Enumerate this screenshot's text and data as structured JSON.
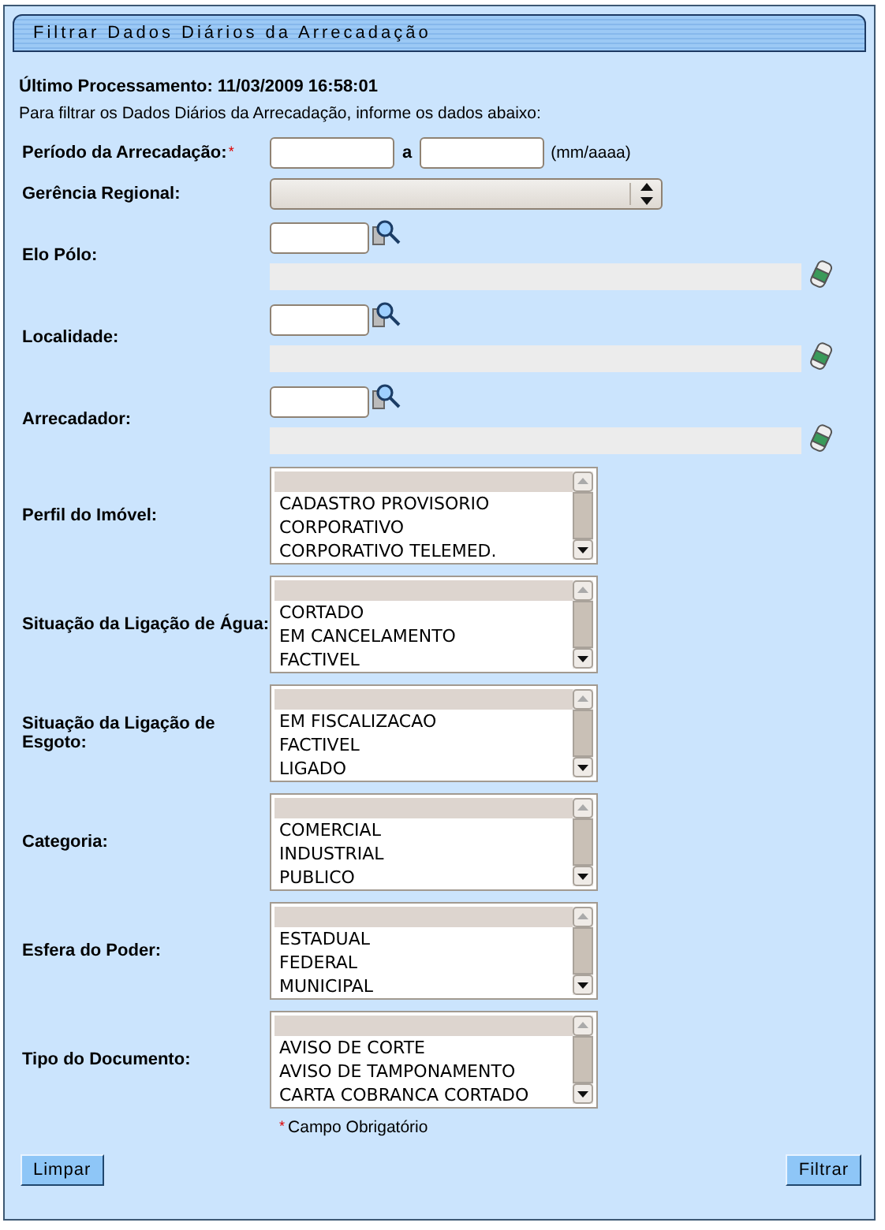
{
  "panel": {
    "title": "Filtrar Dados Diários da Arrecadação"
  },
  "last_processing": "Último Processamento: 11/03/2009 16:58:01",
  "instructions": "Para filtrar os Dados Diários da Arrecadação, informe os dados abaixo:",
  "fields": [
    {
      "kind": "period",
      "label": "Período da Arrecadação:",
      "required_mark": "*",
      "separator": "a",
      "hint": "(mm/aaaa)"
    },
    {
      "kind": "select",
      "label": "Gerência Regional:"
    },
    {
      "kind": "lookup",
      "label": "Elo Pólo:"
    },
    {
      "kind": "lookup",
      "label": "Localidade:"
    },
    {
      "kind": "lookup",
      "label": "Arrecadador:"
    },
    {
      "kind": "listbox",
      "label": "Perfil do Imóvel:",
      "options": [
        "CADASTRO PROVISORIO",
        "CORPORATIVO",
        "CORPORATIVO TELEMED."
      ]
    },
    {
      "kind": "listbox",
      "label": "Situação da Ligação de Água:",
      "options": [
        "CORTADO",
        "EM CANCELAMENTO",
        "FACTIVEL"
      ]
    },
    {
      "kind": "listbox",
      "label": "Situação da Ligação de Esgoto:",
      "options": [
        "EM FISCALIZACAO",
        "FACTIVEL",
        "LIGADO"
      ]
    },
    {
      "kind": "listbox",
      "label": "Categoria:",
      "options": [
        "COMERCIAL",
        "INDUSTRIAL",
        "PUBLICO"
      ]
    },
    {
      "kind": "listbox",
      "label": "Esfera do Poder:",
      "options": [
        "ESTADUAL",
        "FEDERAL",
        "MUNICIPAL"
      ]
    },
    {
      "kind": "listbox",
      "label": "Tipo do Documento:",
      "options": [
        "AVISO DE CORTE",
        "AVISO DE TAMPONAMENTO",
        "CARTA COBRANCA CORTADO"
      ]
    }
  ],
  "required_note": {
    "mark": "*",
    "text": "Campo Obrigatório"
  },
  "buttons": {
    "left": "Limpar",
    "right": "Filtrar"
  }
}
